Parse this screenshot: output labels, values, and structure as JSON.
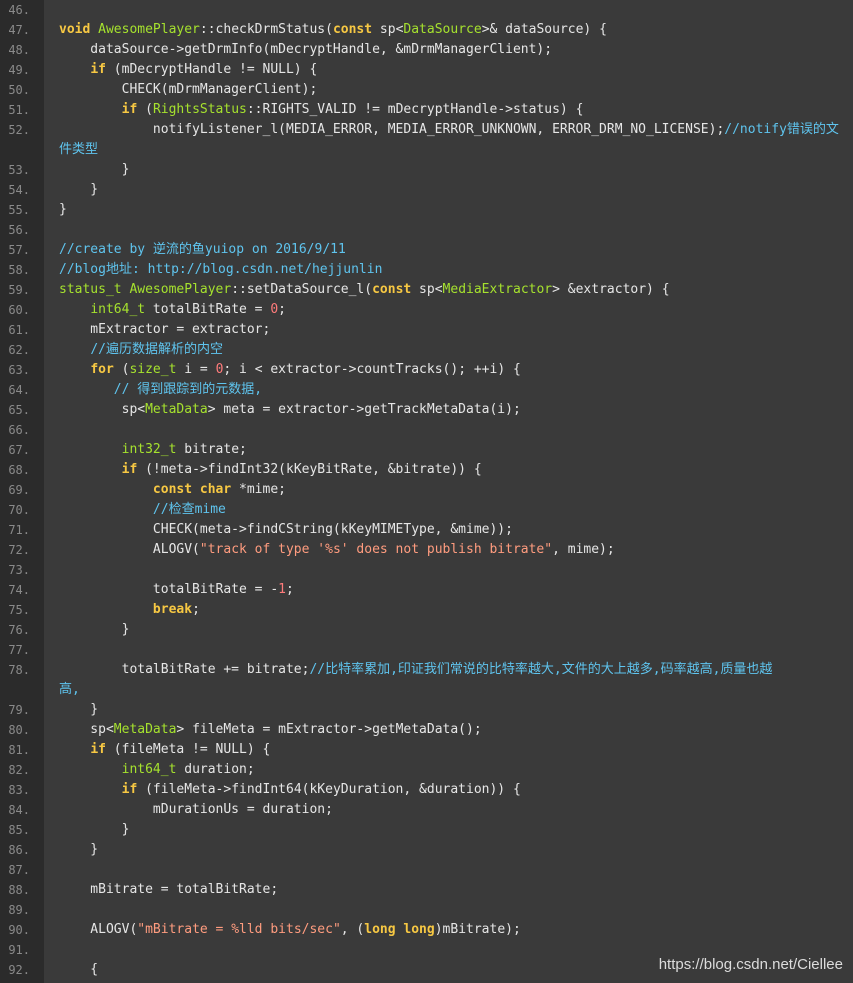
{
  "colors": {
    "gutter_background": "#2b2b2b",
    "code_background": "#3a3a3a",
    "keyword": "#f7c843",
    "type": "#a6e22e",
    "comment": "#5fc4ee",
    "number": "#ff7b7b",
    "string": "#ff9c7f",
    "text": "#e6e6e6",
    "line_number": "#8a8a8a"
  },
  "watermark": "https://blog.csdn.net/Ciellee",
  "lines": [
    {
      "n": "46.",
      "tokens": []
    },
    {
      "n": "47.",
      "tokens": [
        [
          "kw",
          "void"
        ],
        [
          "",
          ""
        ],
        [
          "ty",
          " AwesomePlayer"
        ],
        [
          "",
          "::checkDrmStatus("
        ],
        [
          "kw",
          "const"
        ],
        [
          "",
          " sp<"
        ],
        [
          "ty",
          "DataSource"
        ],
        [
          "",
          ">& dataSource) {"
        ]
      ]
    },
    {
      "n": "48.",
      "tokens": [
        [
          "",
          "    dataSource->getDrmInfo(mDecryptHandle, &mDrmManagerClient);"
        ]
      ]
    },
    {
      "n": "49.",
      "tokens": [
        [
          "",
          "    "
        ],
        [
          "kw",
          "if"
        ],
        [
          "",
          " (mDecryptHandle != NULL) {"
        ]
      ]
    },
    {
      "n": "50.",
      "tokens": [
        [
          "",
          "        CHECK(mDrmManagerClient);"
        ]
      ]
    },
    {
      "n": "51.",
      "tokens": [
        [
          "",
          "        "
        ],
        [
          "kw",
          "if"
        ],
        [
          "",
          " ("
        ],
        [
          "ty",
          "RightsStatus"
        ],
        [
          "",
          "::RIGHTS_VALID != mDecryptHandle->status) {"
        ]
      ]
    },
    {
      "n": "52.",
      "tokens": [
        [
          "",
          "            notifyListener_l(MEDIA_ERROR, MEDIA_ERROR_UNKNOWN, ERROR_DRM_NO_LICENSE);"
        ],
        [
          "cm",
          "//notify错误的文"
        ]
      ],
      "cont": [
        [
          "cm",
          "件类型"
        ]
      ]
    },
    {
      "n": "53.",
      "tokens": [
        [
          "",
          "        }"
        ]
      ]
    },
    {
      "n": "54.",
      "tokens": [
        [
          "",
          "    }"
        ]
      ]
    },
    {
      "n": "55.",
      "tokens": [
        [
          "",
          "}"
        ]
      ]
    },
    {
      "n": "56.",
      "tokens": []
    },
    {
      "n": "57.",
      "tokens": [
        [
          "cm",
          "//create by 逆流的鱼yuiop on 2016/9/11"
        ]
      ]
    },
    {
      "n": "58.",
      "tokens": [
        [
          "cm",
          "//blog地址: http://blog.csdn.net/hejjunlin"
        ]
      ]
    },
    {
      "n": "59.",
      "tokens": [
        [
          "ty",
          "status_t"
        ],
        [
          "ty",
          " AwesomePlayer"
        ],
        [
          "",
          "::setDataSource_l("
        ],
        [
          "kw",
          "const"
        ],
        [
          "",
          " sp<"
        ],
        [
          "ty",
          "MediaExtractor"
        ],
        [
          "",
          "> &extractor) {"
        ]
      ]
    },
    {
      "n": "60.",
      "tokens": [
        [
          "",
          "    "
        ],
        [
          "ty",
          "int64_t"
        ],
        [
          "",
          " totalBitRate = "
        ],
        [
          "num",
          "0"
        ],
        [
          "",
          ";"
        ]
      ]
    },
    {
      "n": "61.",
      "tokens": [
        [
          "",
          "    mExtractor = extractor;"
        ]
      ]
    },
    {
      "n": "62.",
      "tokens": [
        [
          "",
          "    "
        ],
        [
          "cm",
          "//遍历数据解析的内空"
        ]
      ]
    },
    {
      "n": "63.",
      "tokens": [
        [
          "",
          "    "
        ],
        [
          "kw",
          "for"
        ],
        [
          "",
          " ("
        ],
        [
          "ty",
          "size_t"
        ],
        [
          "",
          " i = "
        ],
        [
          "num",
          "0"
        ],
        [
          "",
          "; i < extractor->countTracks(); ++i) {"
        ]
      ]
    },
    {
      "n": "64.",
      "tokens": [
        [
          "",
          "       "
        ],
        [
          "cm",
          "// 得到跟踪到的元数据,"
        ]
      ]
    },
    {
      "n": "65.",
      "tokens": [
        [
          "",
          "        sp<"
        ],
        [
          "ty",
          "MetaData"
        ],
        [
          "",
          "> meta = extractor->getTrackMetaData(i);"
        ]
      ]
    },
    {
      "n": "66.",
      "tokens": []
    },
    {
      "n": "67.",
      "tokens": [
        [
          "",
          "        "
        ],
        [
          "ty",
          "int32_t"
        ],
        [
          "",
          " bitrate;"
        ]
      ]
    },
    {
      "n": "68.",
      "tokens": [
        [
          "",
          "        "
        ],
        [
          "kw",
          "if"
        ],
        [
          "",
          " (!meta->findInt32(kKeyBitRate, &bitrate)) {"
        ]
      ]
    },
    {
      "n": "69.",
      "tokens": [
        [
          "",
          "            "
        ],
        [
          "kw",
          "const char"
        ],
        [
          "",
          " *mime;"
        ]
      ]
    },
    {
      "n": "70.",
      "tokens": [
        [
          "",
          "            "
        ],
        [
          "cm",
          "//检查mime"
        ]
      ]
    },
    {
      "n": "71.",
      "tokens": [
        [
          "",
          "            CHECK(meta->findCString(kKeyMIMEType, &mime));"
        ]
      ]
    },
    {
      "n": "72.",
      "tokens": [
        [
          "",
          "            ALOGV("
        ],
        [
          "str",
          "\"track of type '%s' does not publish bitrate\""
        ],
        [
          "",
          ", mime);"
        ]
      ]
    },
    {
      "n": "73.",
      "tokens": []
    },
    {
      "n": "74.",
      "tokens": [
        [
          "",
          "            totalBitRate = -"
        ],
        [
          "num",
          "1"
        ],
        [
          "",
          ";"
        ]
      ]
    },
    {
      "n": "75.",
      "tokens": [
        [
          "",
          "            "
        ],
        [
          "kw",
          "break"
        ],
        [
          "",
          ";"
        ]
      ]
    },
    {
      "n": "76.",
      "tokens": [
        [
          "",
          "        }"
        ]
      ]
    },
    {
      "n": "77.",
      "tokens": []
    },
    {
      "n": "78.",
      "tokens": [
        [
          "",
          "        totalBitRate += bitrate;"
        ],
        [
          "cm",
          "//比特率累加,印证我们常说的比特率越大,文件的大上越多,码率越高,质量也越"
        ]
      ],
      "cont": [
        [
          "cm",
          "高,"
        ]
      ]
    },
    {
      "n": "79.",
      "tokens": [
        [
          "",
          "    }"
        ]
      ]
    },
    {
      "n": "80.",
      "tokens": [
        [
          "",
          "    sp<"
        ],
        [
          "ty",
          "MetaData"
        ],
        [
          "",
          "> fileMeta = mExtractor->getMetaData();"
        ]
      ]
    },
    {
      "n": "81.",
      "tokens": [
        [
          "",
          "    "
        ],
        [
          "kw",
          "if"
        ],
        [
          "",
          " (fileMeta != NULL) {"
        ]
      ]
    },
    {
      "n": "82.",
      "tokens": [
        [
          "",
          "        "
        ],
        [
          "ty",
          "int64_t"
        ],
        [
          "",
          " duration;"
        ]
      ]
    },
    {
      "n": "83.",
      "tokens": [
        [
          "",
          "        "
        ],
        [
          "kw",
          "if"
        ],
        [
          "",
          " (fileMeta->findInt64(kKeyDuration, &duration)) {"
        ]
      ]
    },
    {
      "n": "84.",
      "tokens": [
        [
          "",
          "            mDurationUs = duration;"
        ]
      ]
    },
    {
      "n": "85.",
      "tokens": [
        [
          "",
          "        }"
        ]
      ]
    },
    {
      "n": "86.",
      "tokens": [
        [
          "",
          "    }"
        ]
      ]
    },
    {
      "n": "87.",
      "tokens": []
    },
    {
      "n": "88.",
      "tokens": [
        [
          "",
          "    mBitrate = totalBitRate;"
        ]
      ]
    },
    {
      "n": "89.",
      "tokens": []
    },
    {
      "n": "90.",
      "tokens": [
        [
          "",
          "    ALOGV("
        ],
        [
          "str",
          "\"mBitrate = %lld bits/sec\""
        ],
        [
          "",
          ", ("
        ],
        [
          "kw",
          "long long"
        ],
        [
          "",
          ")mBitrate);"
        ]
      ]
    },
    {
      "n": "91.",
      "tokens": []
    },
    {
      "n": "92.",
      "tokens": [
        [
          "",
          "    {"
        ]
      ]
    }
  ]
}
